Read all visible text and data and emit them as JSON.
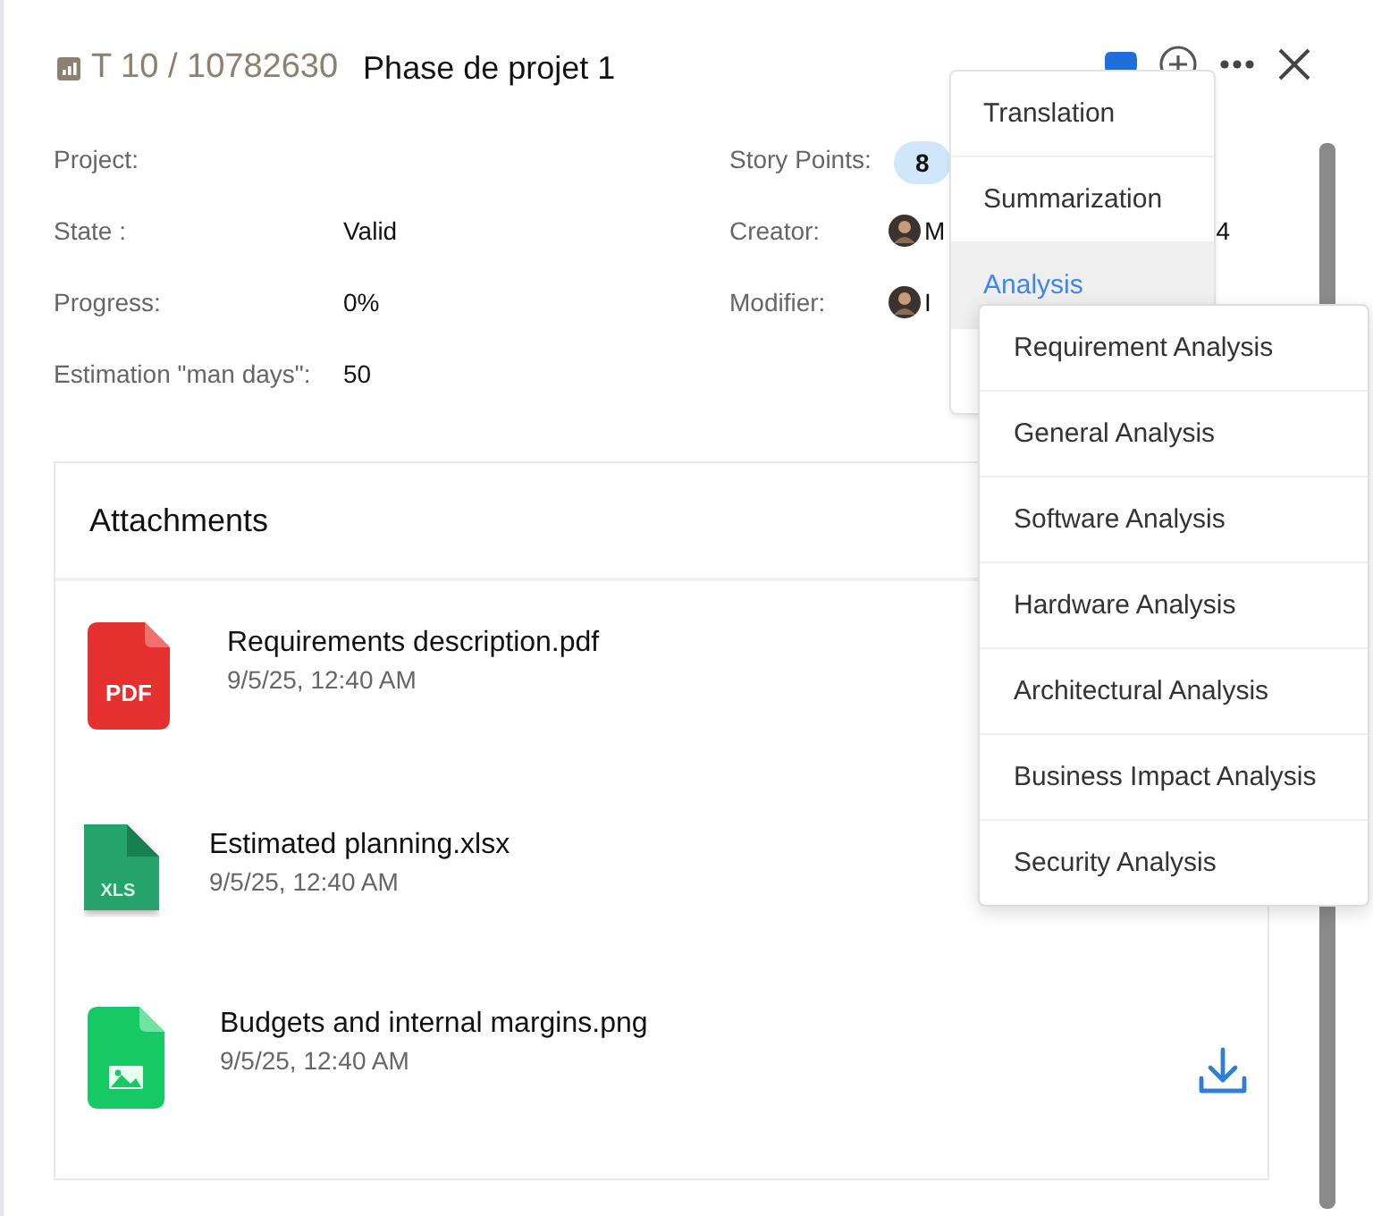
{
  "header": {
    "ticket": "T 10 / 10782630",
    "title": "Phase de projet 1"
  },
  "fields_left": [
    {
      "label": "Project:"
    },
    {
      "label": "State :",
      "value": "Valid"
    },
    {
      "label": "Progress:",
      "value": "0%"
    },
    {
      "label": "Estimation \"man days\":",
      "value": "50"
    }
  ],
  "fields_right": [
    {
      "kind": "badge",
      "label": "Story Points:",
      "value": "8"
    },
    {
      "kind": "person",
      "label": "Creator:",
      "name_start": "M",
      "name_end": "4"
    },
    {
      "kind": "person",
      "label": "Modifier:",
      "name_start": "I"
    }
  ],
  "attachments": {
    "title": "Attachments",
    "files": [
      {
        "kind": "pdf",
        "badge": "PDF",
        "name": "Requirements description.pdf",
        "date": "9/5/25, 12:40 AM",
        "download": false
      },
      {
        "kind": "xls",
        "badge": "XLS",
        "name": "Estimated planning.xlsx",
        "date": "9/5/25, 12:40 AM",
        "download": false
      },
      {
        "kind": "image",
        "name": "Budgets and internal margins.png",
        "date": "9/5/25, 12:40 AM",
        "download": true
      }
    ]
  },
  "menu": [
    {
      "label": "Translation",
      "selected": false
    },
    {
      "label": "Summarization",
      "selected": false
    },
    {
      "label": "Analysis",
      "selected": true
    },
    {
      "selected": false
    }
  ],
  "submenu": [
    "Requirement Analysis",
    "General Analysis",
    "Software Analysis",
    "Hardware Analysis",
    "Architectural Analysis",
    "Business Impact Analysis",
    "Security Analysis"
  ]
}
